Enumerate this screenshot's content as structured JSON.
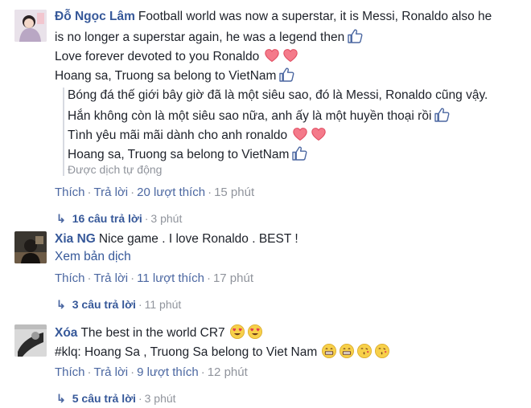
{
  "comments": [
    {
      "author": "Đỗ Ngọc Lâm",
      "lines": [
        "Football world was now a superstar, it is Messi, Ronaldo also he",
        "is no longer a superstar again, he was a legend then",
        "Love forever devoted to you Ronaldo",
        "Hoang sa, Truong sa belong to VietNam"
      ],
      "translation": [
        "Bóng đá thế giới bây giờ đã là một siêu sao, đó là Messi, Ronaldo cũng vậy.",
        "Hắn không còn là một siêu sao nữa, anh ấy là một huyền thoại rồi",
        "Tình yêu mãi mãi dành cho anh ronaldo",
        "Hoang sa, Truong sa belong to VietNam"
      ],
      "translated_note": "Được dịch tự động",
      "like_label": "Thích",
      "reply_label": "Trả lời",
      "likes_text": "20 lượt thích",
      "time": "15 phút",
      "replies_text": "16 câu trả lời",
      "replies_time": "3 phút"
    },
    {
      "author": "Xia NG",
      "text": "Nice game . I love Ronaldo . BEST !",
      "see_translation": "Xem bản dịch",
      "like_label": "Thích",
      "reply_label": "Trả lời",
      "likes_text": "11 lượt thích",
      "time": "17 phút",
      "replies_text": "3 câu trả lời",
      "replies_time": "11 phút"
    },
    {
      "author": "Xóa",
      "text": "The best in the world CR7",
      "line2": "#klq: Hoang Sa , Truong Sa belong to Viet Nam",
      "like_label": "Thích",
      "reply_label": "Trả lời",
      "likes_text": "9 lượt thích",
      "time": "12 phút",
      "replies_text": "5 câu trả lời",
      "replies_time": "3 phút"
    }
  ],
  "icons": {
    "thumbs_up": "thumbs-up-icon",
    "heart": "heart-icon",
    "heart_eyes": "heart-eyes-emoji",
    "reply_arrow": "reply-arrow-icon"
  },
  "colors": {
    "link": "#365899",
    "action_link": "#4b67a1",
    "muted": "#90949c",
    "heart": "#f25268"
  }
}
